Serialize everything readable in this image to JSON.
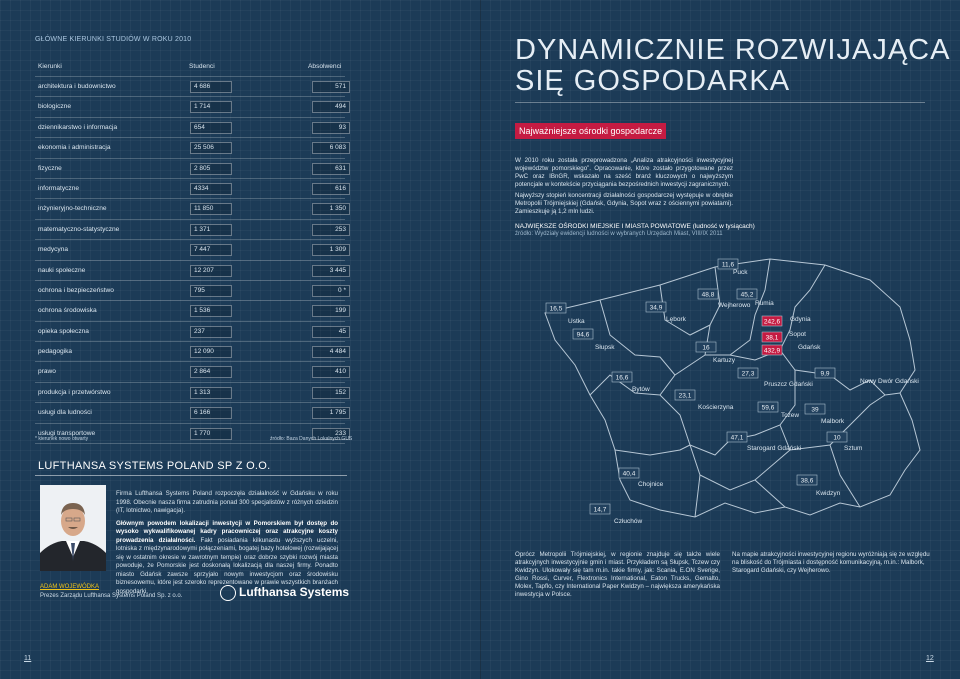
{
  "left": {
    "section_title": "GŁÓWNE KIERUNKI STUDIÓW W ROKU 2010",
    "table": {
      "headers": [
        "Kierunki",
        "Studenci",
        "Absolwenci"
      ],
      "rows": [
        {
          "name": "architektura i budownictwo",
          "students": "4 686",
          "graduates": "571"
        },
        {
          "name": "biologiczne",
          "students": "1 714",
          "graduates": "494"
        },
        {
          "name": "dziennikarstwo i informacja",
          "students": "654",
          "graduates": "93"
        },
        {
          "name": "ekonomia i administracja",
          "students": "25 506",
          "graduates": "6 083"
        },
        {
          "name": "fizyczne",
          "students": "2 805",
          "graduates": "631"
        },
        {
          "name": "informatyczne",
          "students": "4334",
          "graduates": "616"
        },
        {
          "name": "inżynieryjno-techniczne",
          "students": "11 850",
          "graduates": "1 350"
        },
        {
          "name": "matematyczno-statystyczne",
          "students": "1 371",
          "graduates": "253"
        },
        {
          "name": "medycyna",
          "students": "7 447",
          "graduates": "1 309"
        },
        {
          "name": "nauki społeczne",
          "students": "12 207",
          "graduates": "3 445"
        },
        {
          "name": "ochrona i bezpieczeństwo",
          "students": "795",
          "graduates": "0 *"
        },
        {
          "name": "ochrona środowiska",
          "students": "1 536",
          "graduates": "199"
        },
        {
          "name": "opieka społeczna",
          "students": "237",
          "graduates": "45"
        },
        {
          "name": "pedagogika",
          "students": "12 090",
          "graduates": "4 484"
        },
        {
          "name": "prawo",
          "students": "2 864",
          "graduates": "410"
        },
        {
          "name": "produkcja i przetwórstwo",
          "students": "1 313",
          "graduates": "152"
        },
        {
          "name": "usługi dla ludności",
          "students": "6 166",
          "graduates": "1 795"
        },
        {
          "name": "usługi transportowe",
          "students": "1 770",
          "graduates": "233"
        }
      ]
    },
    "footnote": "* kierunek nowo otwarty",
    "source": "źródło: Baza Danych Lokalnych GUS",
    "company": {
      "title": "LUFTHANSA SYSTEMS POLAND SP Z O.O.",
      "p1": "Firma Lufthansa Systems Poland rozpoczęła działalność w Gdańsku w roku 1998. Obecnie nasza firma zatrudnia ponad 300 specjalistów z różnych dziedzin (IT, lotnictwo, nawigacja).",
      "p2_bold": "Głównym powodem lokalizacji inwestycji w Pomorskiem był dostęp do wysoko wykwalifikowanej kadry pracowniczej oraz atrakcyjne koszty prowadzenia działalności.",
      "p2_rest": " Fakt posiadania kilkunastu wyższych uczelni, lotniska z międzynarodowymi połączeniami, bogatej bazy hotelowej (rozwijającej się w ostatnim okresie w zawrotnym tempie) oraz dobrze szybki rozwój miasta powoduje, że Pomorskie jest doskonałą lokalizacją dla naszej firmy. Ponadto miasto Gdańsk zawsze sprzyjało nowym inwestycjom oraz środowisku biznesowemu, które jest szeroko reprezentowane w prawie wszystkich branżach gospodarki.",
      "person_name": "ADAM WOJEWÓDKA",
      "person_role": "Prezes Zarządu Lufthansa Systems Poland Sp. z o.o.",
      "logo_text": "Lufthansa Systems"
    },
    "page_number": "11"
  },
  "right": {
    "title_line1": "DYNAMICZNIE ROZWIJAJĄCA",
    "title_line2": "SIĘ GOSPODARKA",
    "subtitle": "Najważniejsze ośrodki gospodarcze",
    "intro": "W 2010 roku została przeprowadzona „Analiza atrakcyjności inwestycyjnej województw pomorskiego”. Opracowanie, które zostało przygotowane przez PwC oraz IBnGR, wskazało na sześć branż kluczowych o najwyższym potencjale w kontekście przyciągania bezpośrednich inwestycji zagranicznych.",
    "intro2": "Najwyższy stopień koncentracji działalności gospodarczej występuje w obrębie Metropolii Trójmiejskiej (Gdańsk, Gdynia, Sopot wraz z ościennymi powiatami). Zamieszkuje ją 1,2 mln ludzi.",
    "map_title": "NAJWIĘKSZE OŚRODKI MIEJSKIE I MIASTA POWIATOWE (ludność w tysiącach)",
    "map_source": "źródło: Wydziały ewidencji ludności w wybranych Urzędach Miast, VIII/IX 2011",
    "cities": [
      {
        "name": "Puck",
        "value": "11,6"
      },
      {
        "name": "Wejherowo",
        "value": "48,8"
      },
      {
        "name": "Rumia",
        "value": "45,2"
      },
      {
        "name": "Ustka",
        "value": "16,5"
      },
      {
        "name": "Lębork",
        "value": "34,9"
      },
      {
        "name": "Gdynia",
        "value": "242,6"
      },
      {
        "name": "Sopot",
        "value": "38,1"
      },
      {
        "name": "Gdańsk",
        "value": "432,9"
      },
      {
        "name": "Słupsk",
        "value": "94,6"
      },
      {
        "name": "Kartuzy",
        "value": "16"
      },
      {
        "name": "Bytów",
        "value": "16,6"
      },
      {
        "name": "Pruszcz Gdański",
        "value": "27,3"
      },
      {
        "name": "Nowy Dwór Gdański",
        "value": "9,9"
      },
      {
        "name": "Kościerzyna",
        "value": "23,1"
      },
      {
        "name": "Tczew",
        "value": "59,6"
      },
      {
        "name": "Malbork",
        "value": "39"
      },
      {
        "name": "Starogard Gdański",
        "value": "47,1"
      },
      {
        "name": "Sztum",
        "value": "10"
      },
      {
        "name": "Chojnice",
        "value": "40,4"
      },
      {
        "name": "Kwidzyn",
        "value": "38,6"
      },
      {
        "name": "Człuchów",
        "value": "14,7"
      }
    ],
    "bottom1": "Oprócz Metropolii Trójmiejskiej, w regionie znajduje się także wiele atrakcyjnych inwestycyjnie gmin i miast. Przykładem są Słupsk, Tczew czy Kwidzyn. Ulokowały się tam m.in. takie firmy, jak: Scania, E.ON Sverige, Gino Rossi, Curver, Flextronics International, Eaton Trucks, Gemalto, Molex, Tapflo, czy International Paper Kwidzyn – największa amerykańska inwestycja w Polsce.",
    "bottom2": "Na mapie atrakcyjności inwestycyjnej regionu wyróżniają się ze względu na bliskość do Trójmiasta i dostępność komunikacyjną, m.in.: Malbork, Starogard Gdański, czy Wejherowo.",
    "page_number": "12",
    "highlight_color": "#c51b42"
  }
}
